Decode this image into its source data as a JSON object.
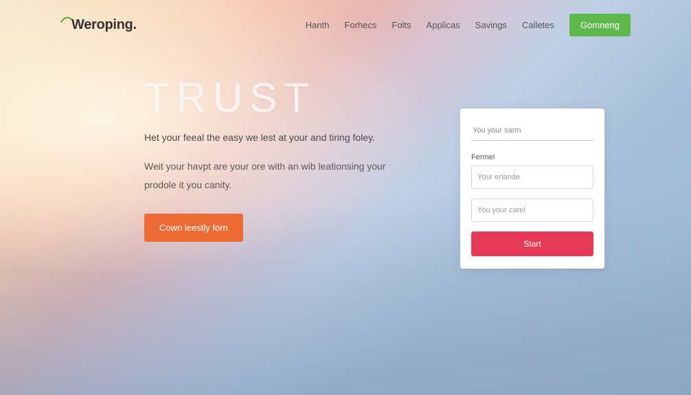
{
  "brand": {
    "name": "Weroping."
  },
  "nav": {
    "links": [
      "Hanth",
      "Forhecs",
      "Folts",
      "Applicas",
      "Savings",
      "Calletes"
    ],
    "cta": "Gomneng"
  },
  "hero": {
    "title": "TRUST",
    "subtitle": "Het your feeal the easy we lest at your and tiring foley.",
    "description": "Weit your havpt are your ore with an wib leationsing your prodole it you canity.",
    "cta": "Cown leestly forn"
  },
  "form": {
    "field1_placeholder": "You your sarm",
    "label": "Fermel",
    "field2_placeholder": "Your erlande",
    "field3_placeholder": "You your carel",
    "submit": "Start"
  }
}
